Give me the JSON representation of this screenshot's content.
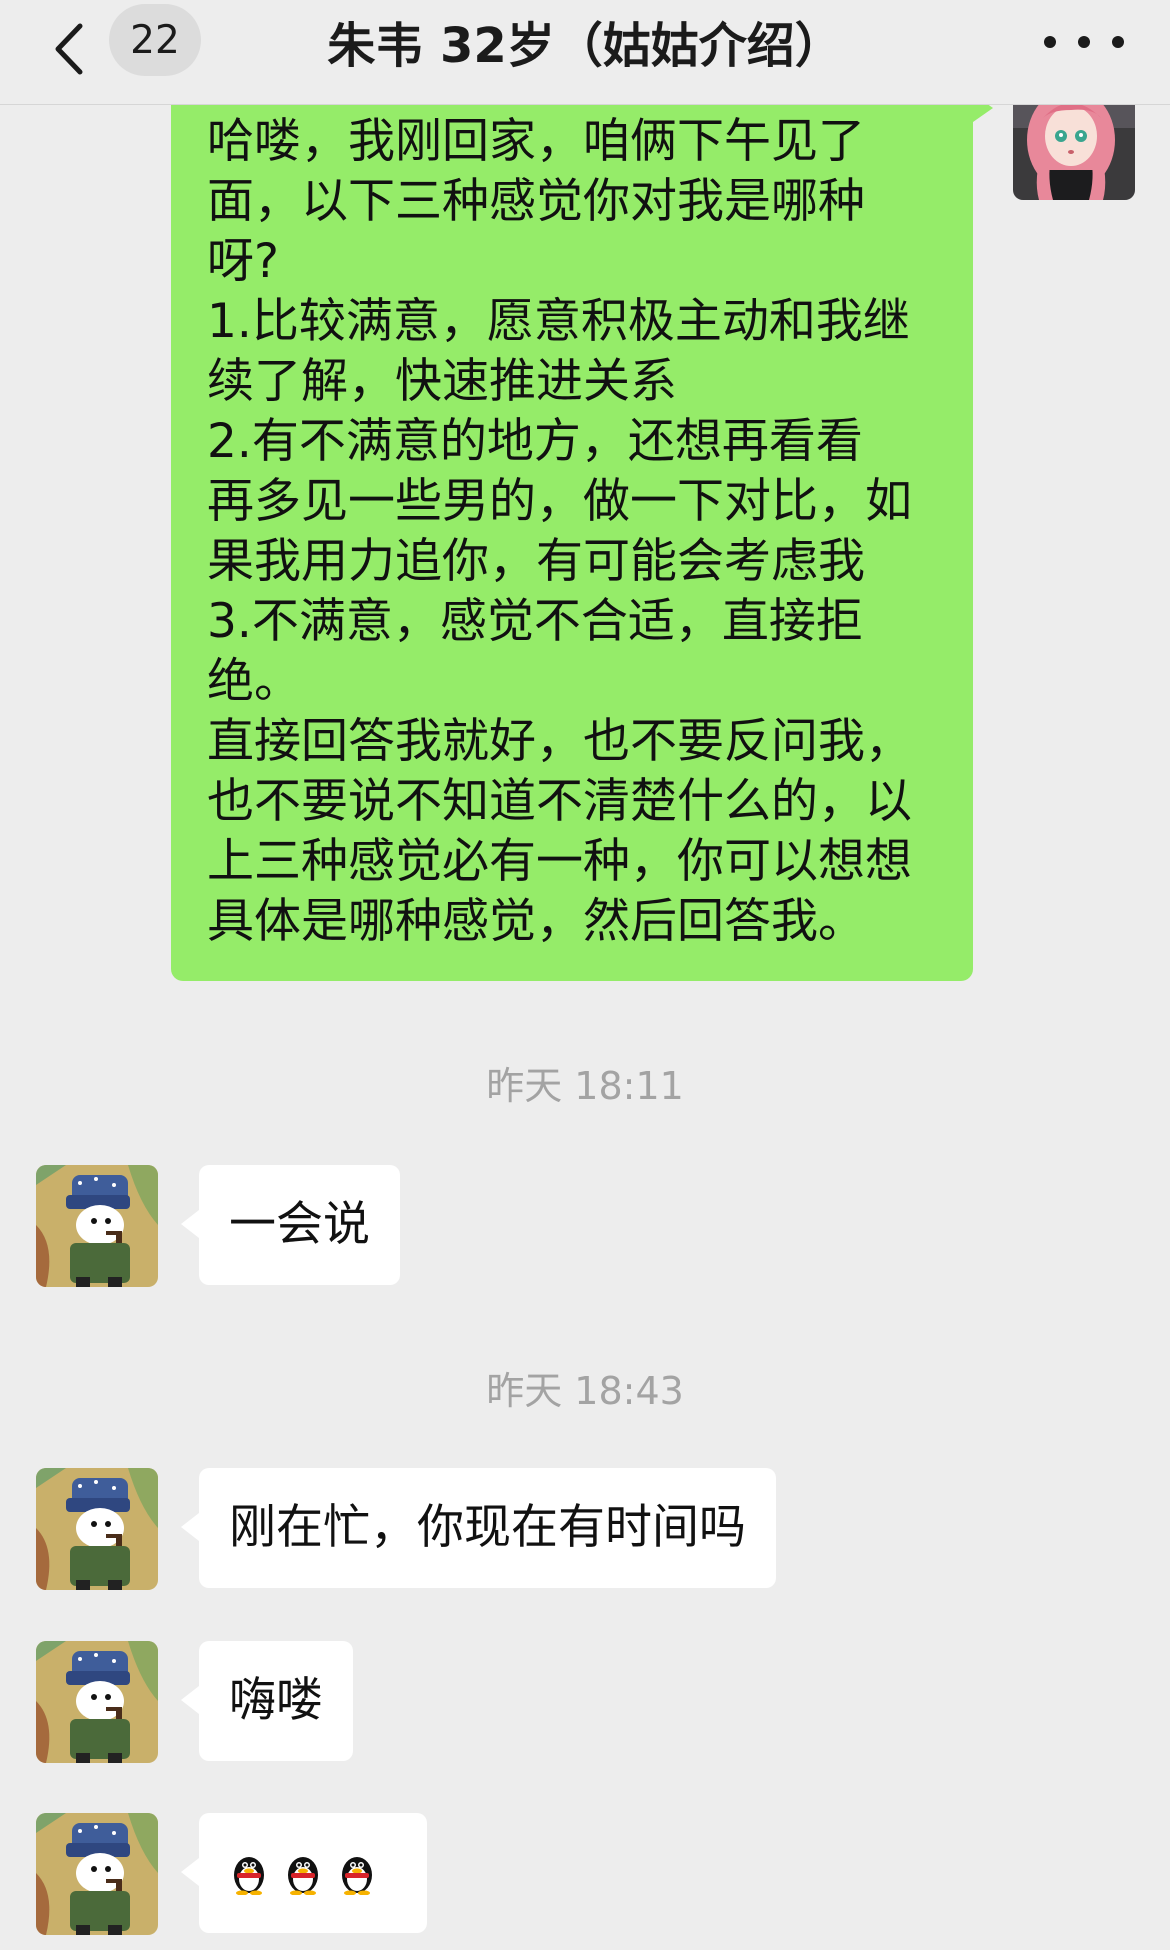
{
  "header": {
    "back_label": "<",
    "unread_count": "22",
    "title": "朱韦 32岁（姑姑介绍）",
    "more_icon": "more-dots-icon"
  },
  "sent_message": {
    "lines": [
      "哈喽，我刚回家，咱俩下午见了",
      "面，以下三种感觉你对我是哪种",
      "呀?",
      "1.比较满意，愿意积极主动和我继",
      "续了解，快速推进关系",
      "2.有不满意的地方，还想再看看",
      "再多见一些男的，做一下对比，如",
      "果我用力追你，有可能会考虑我",
      "3.不满意，感觉不合适，直接拒",
      "绝。",
      "直接回答我就好，也不要反问我，",
      "也不要说不知道不清楚什么的，以",
      "上三种感觉必有一种，你可以想想",
      "具体是哪种感觉，然后回答我。"
    ],
    "avatar": "anime-girl-avatar"
  },
  "timestamps": [
    "昨天 18:11",
    "昨天 18:43"
  ],
  "received_messages": [
    {
      "text": "一会说"
    },
    {
      "text": "刚在忙，你现在有时间吗"
    },
    {
      "text": "嗨喽"
    },
    {
      "emoji": [
        "penguin-icon",
        "penguin-icon",
        "penguin-icon"
      ]
    }
  ],
  "colors": {
    "background": "#ededed",
    "sent_bubble": "#95ec69",
    "received_bubble": "#ffffff",
    "timestamp": "#a3a3a3"
  }
}
